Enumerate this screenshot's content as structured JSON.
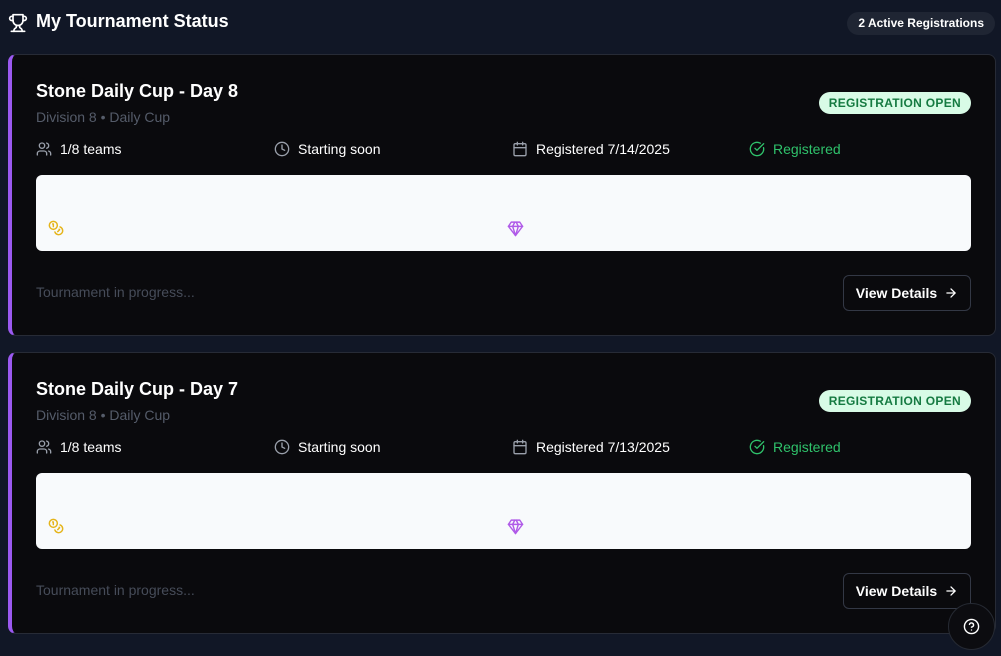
{
  "header": {
    "title": "My Tournament Status",
    "active_count": "2 Active Registrations",
    "icon": "trophy-icon"
  },
  "tournaments": [
    {
      "title": "Stone Daily Cup - Day 8",
      "subtitle": "Division 8 • Daily Cup",
      "status": "REGISTRATION OPEN",
      "teams": "1/8 teams",
      "start": "Starting soon",
      "registered_date": "Registered 7/14/2025",
      "registration_state": "Registered",
      "footer": "Tournament in progress...",
      "button": "View Details"
    },
    {
      "title": "Stone Daily Cup - Day 7",
      "subtitle": "Division 8 • Daily Cup",
      "status": "REGISTRATION OPEN",
      "teams": "1/8 teams",
      "start": "Starting soon",
      "registered_date": "Registered 7/13/2025",
      "registration_state": "Registered",
      "footer": "Tournament in progress...",
      "button": "View Details"
    }
  ],
  "help": {
    "icon": "help-circle-icon"
  },
  "colors": {
    "background": "#111726",
    "card": "#0a0a0d",
    "accent": "#9b59f0",
    "success": "#2fc26b",
    "badge_bg": "#d8fbe6",
    "badge_text": "#157a41",
    "coin": "#e5b41a",
    "gem": "#b05ae8"
  }
}
